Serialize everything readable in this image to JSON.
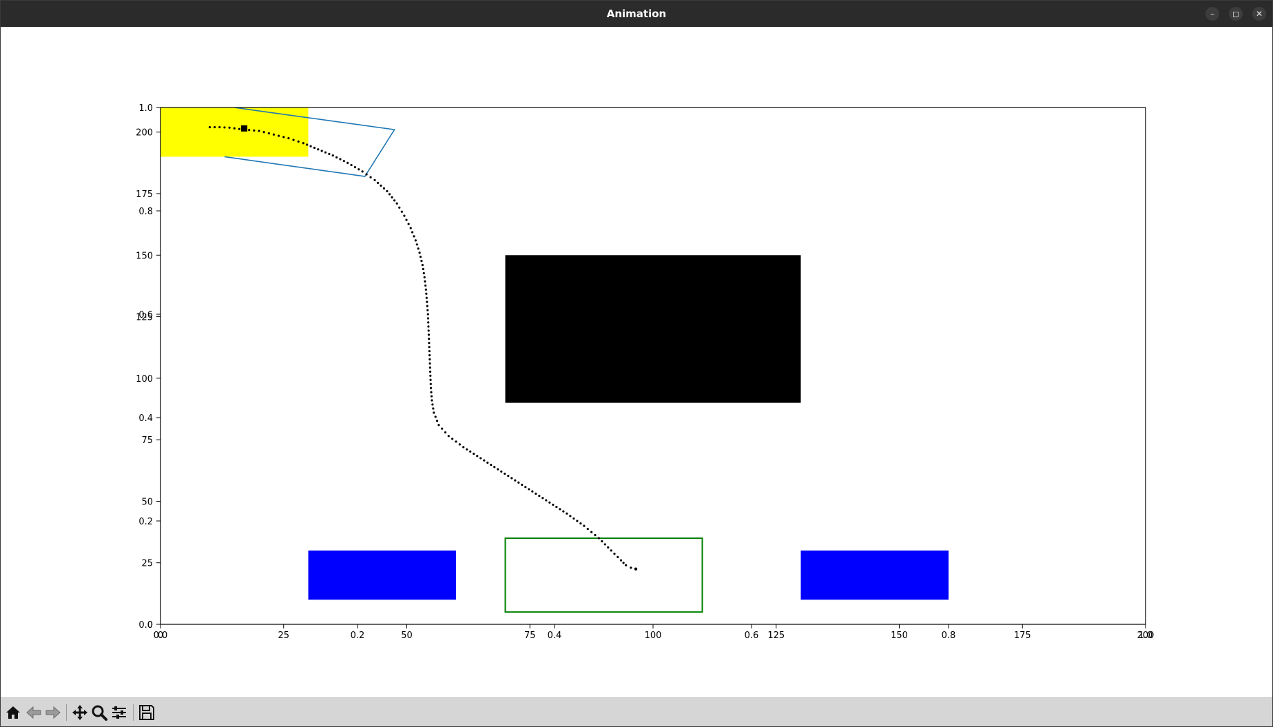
{
  "window": {
    "title": "Animation",
    "controls": {
      "minimize": "–",
      "maximize": "◻",
      "close": "✕"
    }
  },
  "plot": {
    "outer_axes": {
      "xlim": [
        0,
        200
      ],
      "ylim": [
        0,
        210
      ],
      "x_ticks": [
        "0",
        "25",
        "50",
        "75",
        "100",
        "125",
        "150",
        "175",
        "200"
      ],
      "y_ticks": [
        "0",
        "25",
        "50",
        "75",
        "100",
        "125",
        "150",
        "175",
        "200"
      ]
    },
    "inner_axes": {
      "xlim": [
        0,
        1
      ],
      "ylim": [
        0,
        1
      ],
      "x_ticks": [
        "0.0",
        "0.2",
        "0.4",
        "0.6",
        "0.8",
        "1.0"
      ],
      "y_ticks": [
        "0.0",
        "0.2",
        "0.4",
        "0.6",
        "0.8",
        "1.0"
      ]
    },
    "shapes": {
      "start_zone": {
        "color": "#ffff00",
        "x": [
          0,
          30
        ],
        "y": [
          190,
          210
        ]
      },
      "obstacle": {
        "color": "#000000",
        "x": [
          70,
          130
        ],
        "y": [
          90,
          150
        ]
      },
      "blue_left": {
        "color": "#0000ff",
        "x": [
          30,
          60
        ],
        "y": [
          10,
          30
        ]
      },
      "blue_right": {
        "color": "#0000ff",
        "x": [
          130,
          160
        ],
        "y": [
          10,
          30
        ]
      },
      "goal": {
        "color": "#008000",
        "x": [
          70,
          110
        ],
        "y": [
          5,
          35
        ]
      },
      "vehicle": {
        "color": "#1f77b4",
        "points": [
          [
            15,
            210
          ],
          [
            47.5,
            201
          ],
          [
            41.5,
            182
          ],
          [
            13,
            190
          ]
        ]
      }
    },
    "trajectory": [
      [
        10,
        202
      ],
      [
        12,
        202
      ],
      [
        14,
        201.8
      ],
      [
        17,
        201
      ],
      [
        20,
        200.5
      ],
      [
        23,
        199
      ],
      [
        26,
        197.5
      ],
      [
        29,
        195.5
      ],
      [
        32,
        193
      ],
      [
        35,
        190.5
      ],
      [
        38,
        187.5
      ],
      [
        41,
        184
      ],
      [
        43.5,
        180.5
      ],
      [
        46,
        176
      ],
      [
        48,
        171
      ],
      [
        49.5,
        166
      ],
      [
        50.8,
        161
      ],
      [
        51.8,
        156
      ],
      [
        52.6,
        151
      ],
      [
        53.2,
        146
      ],
      [
        53.6,
        141
      ],
      [
        53.9,
        136
      ],
      [
        54.1,
        131
      ],
      [
        54.3,
        126
      ],
      [
        54.4,
        121
      ],
      [
        54.5,
        116
      ],
      [
        54.6,
        111
      ],
      [
        54.7,
        106
      ],
      [
        54.8,
        101
      ],
      [
        54.9,
        96
      ],
      [
        55.1,
        91
      ],
      [
        55.5,
        86
      ],
      [
        56.5,
        81
      ],
      [
        58.5,
        76.5
      ],
      [
        61.5,
        72
      ],
      [
        65,
        67.5
      ],
      [
        68.5,
        63
      ],
      [
        72,
        58.5
      ],
      [
        75.5,
        54
      ],
      [
        79,
        49.5
      ],
      [
        82.5,
        45
      ],
      [
        86,
        40
      ],
      [
        89,
        35
      ],
      [
        91.5,
        30
      ],
      [
        93.5,
        26
      ],
      [
        94.5,
        24
      ],
      [
        95.5,
        23
      ],
      [
        96.5,
        22.5
      ]
    ],
    "current_position": [
      17,
      201.5
    ]
  },
  "toolbar": {
    "buttons": [
      "home-icon",
      "back-icon",
      "forward-icon",
      "pan-icon",
      "zoom-icon",
      "configure-subplots-icon",
      "save-icon"
    ]
  }
}
